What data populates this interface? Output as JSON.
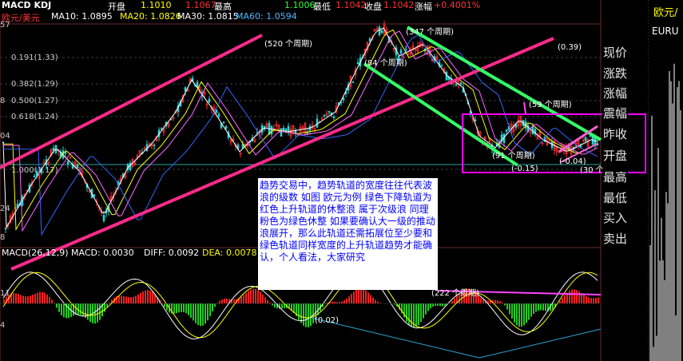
{
  "topbar": {
    "title": "MACD KDJ",
    "open_label": "开盘",
    "open_value": "1.1010",
    "high_label": "最高",
    "high_value": "1.1067",
    "low_label": "最低",
    "low_value": "1.1006",
    "close_label": "收盘",
    "close_value": "1.1042",
    "change_label": "涨幅",
    "change_value": "+0.4001%"
  },
  "ma_strip": {
    "symbol": "欧元/美元",
    "ma10": "MA10: 1.0895",
    "ma20": "MA20: 1.0826",
    "ma30": "MA30: 1.0815",
    "ma60": "MA60: 1.0594"
  },
  "fib_levels": [
    "0.191(1.33)",
    "0.382(1.29)",
    "0.500(1.27)",
    "0.618(1.24)",
    "1.000(1.17)"
  ],
  "axis_fragments": [
    "57",
    "8",
    "04",
    "24",
    "8",
    "11",
    "4"
  ],
  "channel_labels": {
    "c520": "(520 个周期)",
    "c347": "(347 个周期)",
    "p039": "(0.39)",
    "c84": "(84 个周期)",
    "c59": "(59 个周期)",
    "c91": "(91 个周期)",
    "m015": "(-0.15)",
    "m004": "(-0.04)",
    "c30": "(30 个",
    "c222": "(222 个周期)",
    "m002": "(0.02)"
  },
  "macd_strip": {
    "label": "MACD(26,12,9) MACD: 0.0030",
    "diff": "DIFF: 0.0092",
    "dea": "DEA: 0.0078"
  },
  "note_text": "趋势交易中，趋势轨道的宽度往往代表波浪的级数 如图 欧元为例 绿色下降轨道为红色上升轨道的休整浪 属于次级浪 同理粉色为绿色休整 如果要确认大一级的推动浪展开，那么此轨道还需拓展位至少要和绿色轨道同样宽度的上升轨道趋势才能确认，个人看法，大家研究",
  "right_menu": [
    "现价",
    "涨跌",
    "涨幅",
    "震幅",
    "昨收",
    "开盘",
    "最高",
    "最低",
    "买入",
    "卖出"
  ],
  "far_right": {
    "title": "欧元/",
    "code": "EURU"
  },
  "colors": {
    "pink_channel": "#ff2a8c",
    "green_channel": "#33ff66",
    "magenta_box": "#ff00ff",
    "macd_up": "#ff2020",
    "macd_down": "#22cc22"
  }
}
